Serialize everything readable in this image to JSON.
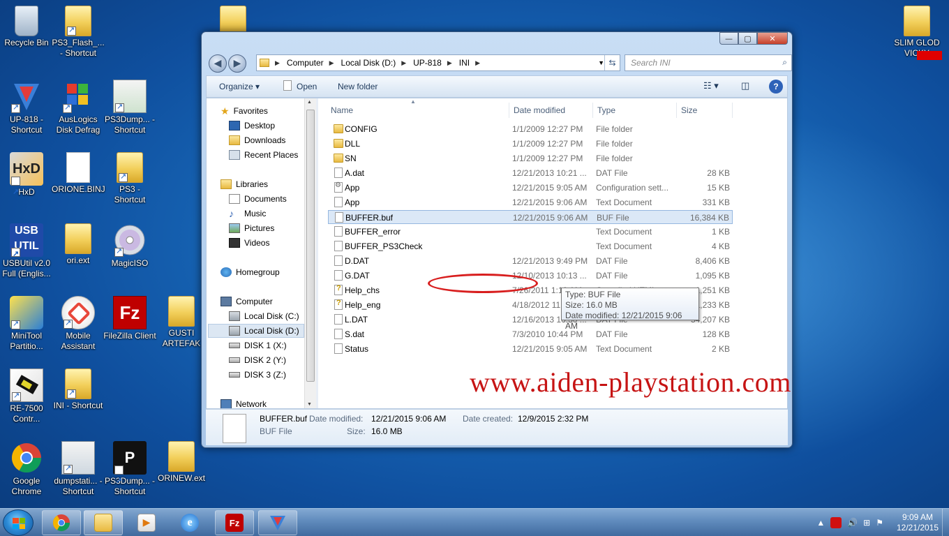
{
  "desktop": {
    "icons": [
      {
        "label": "Recycle Bin"
      },
      {
        "label": "PS3_Flash_... - Shortcut"
      },
      {
        "label": "UP-818 - Shortcut"
      },
      {
        "label": "AusLogics Disk Defrag"
      },
      {
        "label": "PS3Dump... - Shortcut"
      },
      {
        "label": "HxD"
      },
      {
        "label": "ORIONE.BINJ"
      },
      {
        "label": "PS3 - Shortcut"
      },
      {
        "label": "USBUtil v2.0 Full (Englis..."
      },
      {
        "label": "ori.ext"
      },
      {
        "label": "MagicISO"
      },
      {
        "label": "MiniTool Partitio..."
      },
      {
        "label": "Mobile Assistant"
      },
      {
        "label": "FileZilla Client"
      },
      {
        "label": "GUSTI ARTEFAK"
      },
      {
        "label": "RE-7500 Contr..."
      },
      {
        "label": "INI - Shortcut"
      },
      {
        "label": "Google Chrome"
      },
      {
        "label": "dumpstati... - Shortcut"
      },
      {
        "label": "PS3Dump... - Shortcut"
      },
      {
        "label": "ORINEW.ext"
      },
      {
        "label": "SLIM GLOD VICKY"
      }
    ]
  },
  "window": {
    "breadcrumb": [
      "Computer",
      "Local Disk (D:)",
      "UP-818",
      "INI"
    ],
    "search_placeholder": "Search INI",
    "controls": {
      "minimize": "—",
      "maximize": "▢",
      "close": "✕"
    },
    "toolbar": {
      "organize": "Organize ▾",
      "open": "Open",
      "new_folder": "New folder"
    },
    "nav": {
      "favorites": "Favorites",
      "desktop": "Desktop",
      "downloads": "Downloads",
      "recent": "Recent Places",
      "libraries": "Libraries",
      "documents": "Documents",
      "music": "Music",
      "pictures": "Pictures",
      "videos": "Videos",
      "homegroup": "Homegroup",
      "computer": "Computer",
      "disk_c": "Local Disk (C:)",
      "disk_d": "Local Disk (D:)",
      "disk_x": "DISK 1 (X:)",
      "disk_y": "DISK 2 (Y:)",
      "disk_z": "DISK 3 (Z:)",
      "network": "Network"
    },
    "columns": {
      "name": "Name",
      "date": "Date modified",
      "type": "Type",
      "size": "Size"
    },
    "files": [
      {
        "name": "CONFIG",
        "date": "1/1/2009 12:27 PM",
        "type": "File folder",
        "size": "",
        "icon": "folder"
      },
      {
        "name": "DLL",
        "date": "1/1/2009 12:27 PM",
        "type": "File folder",
        "size": "",
        "icon": "folder"
      },
      {
        "name": "SN",
        "date": "1/1/2009 12:27 PM",
        "type": "File folder",
        "size": "",
        "icon": "folder"
      },
      {
        "name": "A.dat",
        "date": "12/21/2013 10:21 ...",
        "type": "DAT File",
        "size": "28 KB",
        "icon": "doc"
      },
      {
        "name": "App",
        "date": "12/21/2015 9:05 AM",
        "type": "Configuration sett...",
        "size": "15 KB",
        "icon": "cfg"
      },
      {
        "name": "App",
        "date": "12/21/2015 9:06 AM",
        "type": "Text Document",
        "size": "331 KB",
        "icon": "doc"
      },
      {
        "name": "BUFFER.buf",
        "date": "12/21/2015 9:06 AM",
        "type": "BUF File",
        "size": "16,384 KB",
        "icon": "doc"
      },
      {
        "name": "BUFFER_error",
        "date": "",
        "type": "Text Document",
        "size": "1 KB",
        "icon": "doc"
      },
      {
        "name": "BUFFER_PS3Check",
        "date": "",
        "type": "Text Document",
        "size": "4 KB",
        "icon": "doc"
      },
      {
        "name": "D.DAT",
        "date": "12/21/2013 9:49 PM",
        "type": "DAT File",
        "size": "8,406 KB",
        "icon": "doc"
      },
      {
        "name": "G.DAT",
        "date": "12/10/2013 10:13 ...",
        "type": "DAT File",
        "size": "1,095 KB",
        "icon": "doc"
      },
      {
        "name": "Help_chs",
        "date": "7/26/2011 1:10 AM",
        "type": "Compiled HTML ...",
        "size": "1,251 KB",
        "icon": "chm"
      },
      {
        "name": "Help_eng",
        "date": "4/18/2012 11:41 PM",
        "type": "Compiled HTML ...",
        "size": "1,233 KB",
        "icon": "chm"
      },
      {
        "name": "L.DAT",
        "date": "12/16/2013 10:30 ...",
        "type": "DAT File",
        "size": "54,207 KB",
        "icon": "doc"
      },
      {
        "name": "S.dat",
        "date": "7/3/2010 10:44 PM",
        "type": "DAT File",
        "size": "128 KB",
        "icon": "doc"
      },
      {
        "name": "Status",
        "date": "12/21/2015 9:05 AM",
        "type": "Text Document",
        "size": "2 KB",
        "icon": "doc"
      }
    ],
    "selected_index": 6,
    "tooltip": {
      "type": "Type: BUF File",
      "size": "Size: 16.0 MB",
      "modified": "Date modified: 12/21/2015 9:06 AM"
    },
    "watermark": "www.aiden-playstation.com",
    "details": {
      "name": "BUFFER.buf",
      "kind": "BUF File",
      "date_modified_label": "Date modified:",
      "date_modified": "12/21/2015 9:06 AM",
      "date_created_label": "Date created:",
      "date_created": "12/9/2015 2:32 PM",
      "size_label": "Size:",
      "size": "16.0 MB"
    }
  },
  "taskbar": {
    "time": "9:09 AM",
    "date": "12/21/2015"
  },
  "colors": {
    "annotation": "#d81e1e",
    "watermark": "#c61414",
    "selection": "#dbe8f7"
  }
}
